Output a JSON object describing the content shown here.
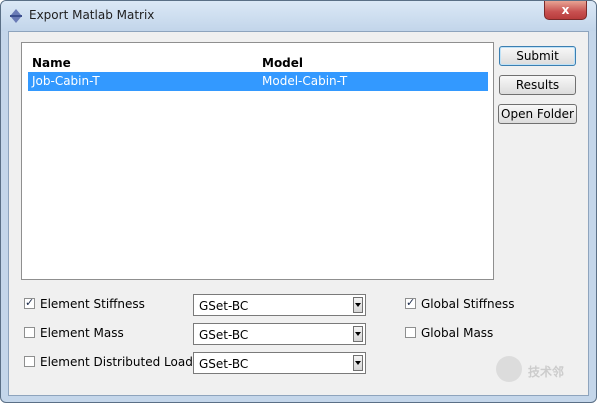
{
  "window": {
    "title": "Export Matlab Matrix",
    "close_glyph": "x"
  },
  "table": {
    "headers": {
      "name": "Name",
      "model": "Model"
    },
    "rows": [
      {
        "name": "Job-Cabin-T",
        "model": "Model-Cabin-T",
        "selected": true
      }
    ]
  },
  "buttons": {
    "submit": "Submit",
    "results": "Results",
    "open_folder": "Open Folder"
  },
  "options": {
    "element_stiffness": {
      "label": "Element Stiffness",
      "checked": true,
      "select": "GSet-BC"
    },
    "element_mass": {
      "label": "Element Mass",
      "checked": false,
      "select": "GSet-BC"
    },
    "element_distributed_load": {
      "label": "Element Distributed Load",
      "checked": false,
      "select": "GSet-BC"
    },
    "global_stiffness": {
      "label": "Global Stiffness",
      "checked": true
    },
    "global_mass": {
      "label": "Global Mass",
      "checked": false
    }
  },
  "watermark": {
    "text": "技术邻",
    "icon": "mascot-icon"
  },
  "colors": {
    "selection": "#3399ff",
    "dialog_bg": "#f0f0f0",
    "frame": "#c4d6ea"
  }
}
